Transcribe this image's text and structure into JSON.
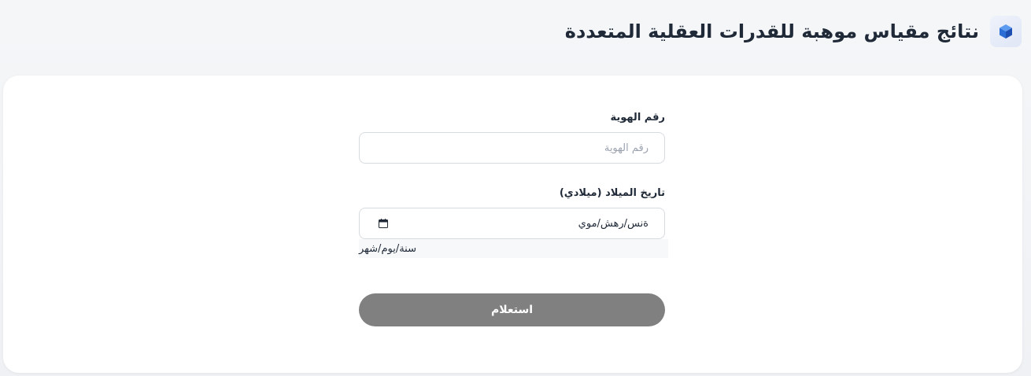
{
  "header": {
    "title": "نتائج مقياس موهبة للقدرات العقلية المتعددة",
    "logo_icon": "cube-logo-icon"
  },
  "form": {
    "id_label": "رقم الهوية",
    "id_placeholder": "رقم الهوية",
    "id_value": "",
    "dob_label": "تاريخ الميلاد (ميلادي)",
    "dob_value": "ةنس/رهش/موي",
    "dob_icon": "calendar-icon",
    "dob_hint": "سنة/يوم/شهر",
    "submit_label": "استعلام"
  },
  "colors": {
    "button_bg": "#808080",
    "card_bg": "#ffffff",
    "logo_accent": "#2b6fd6"
  }
}
